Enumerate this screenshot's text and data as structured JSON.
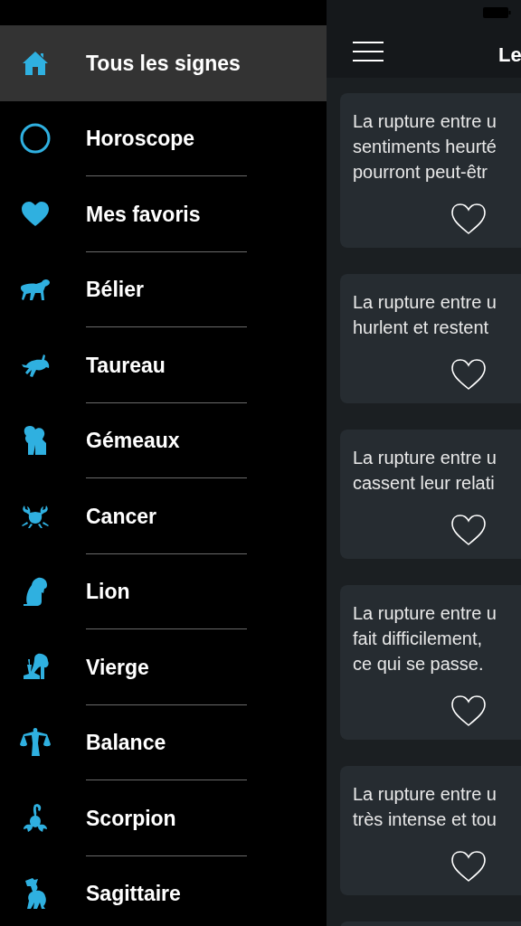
{
  "sidebar": {
    "items": [
      {
        "label": "Tous les signes",
        "selected": true
      },
      {
        "label": "Horoscope",
        "selected": false
      },
      {
        "label": "Mes favoris",
        "selected": false
      },
      {
        "label": "Bélier",
        "selected": false
      },
      {
        "label": "Taureau",
        "selected": false
      },
      {
        "label": "Gémeaux",
        "selected": false
      },
      {
        "label": "Cancer",
        "selected": false
      },
      {
        "label": "Lion",
        "selected": false
      },
      {
        "label": "Vierge",
        "selected": false
      },
      {
        "label": "Balance",
        "selected": false
      },
      {
        "label": "Scorpion",
        "selected": false
      },
      {
        "label": "Sagittaire",
        "selected": false
      }
    ]
  },
  "header": {
    "title": "Le"
  },
  "cards": [
    {
      "lines": [
        "La rupture entre u",
        "sentiments heurté",
        "pourront peut-êtr"
      ]
    },
    {
      "lines": [
        "La rupture entre u",
        "hurlent et restent"
      ]
    },
    {
      "lines": [
        "La rupture entre u",
        "cassent leur relati"
      ]
    },
    {
      "lines": [
        "La rupture entre u",
        "fait difficilement,",
        "ce qui se passe."
      ]
    },
    {
      "lines": [
        "La rupture entre u",
        "très intense et tou"
      ]
    }
  ]
}
